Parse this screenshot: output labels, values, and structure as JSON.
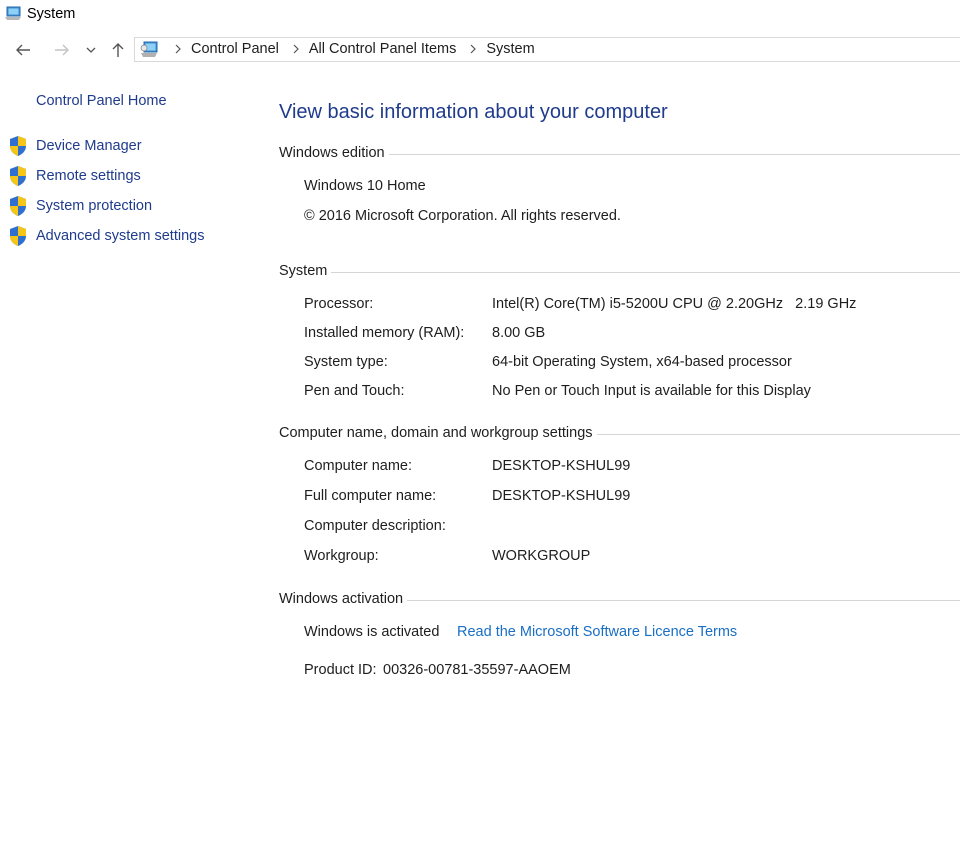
{
  "window": {
    "title": "System"
  },
  "nav": {
    "breadcrumbs": [
      "Control Panel",
      "All Control Panel Items",
      "System"
    ]
  },
  "sidebar": {
    "home": "Control Panel Home",
    "tasks": [
      {
        "label": "Device Manager"
      },
      {
        "label": "Remote settings"
      },
      {
        "label": "System protection"
      },
      {
        "label": "Advanced system settings"
      }
    ]
  },
  "main": {
    "heading": "View basic information about your computer",
    "edition": {
      "title": "Windows edition",
      "name": "Windows 10 Home",
      "copyright": "© 2016 Microsoft Corporation. All rights reserved."
    },
    "system": {
      "title": "System",
      "rows": [
        {
          "label": "Processor:",
          "value": "Intel(R) Core(TM) i5-5200U CPU @ 2.20GHz   2.19 GHz"
        },
        {
          "label": "Installed memory (RAM):",
          "value": "8.00 GB"
        },
        {
          "label": "System type:",
          "value": "64-bit Operating System, x64-based processor"
        },
        {
          "label": "Pen and Touch:",
          "value": "No Pen or Touch Input is available for this Display"
        }
      ]
    },
    "computer": {
      "title": "Computer name, domain and workgroup settings",
      "rows": [
        {
          "label": "Computer name:",
          "value": "DESKTOP-KSHUL99"
        },
        {
          "label": "Full computer name:",
          "value": "DESKTOP-KSHUL99"
        },
        {
          "label": "Computer description:",
          "value": ""
        },
        {
          "label": "Workgroup:",
          "value": "WORKGROUP"
        }
      ]
    },
    "activation": {
      "title": "Windows activation",
      "status": "Windows is activated",
      "license_link": "Read the Microsoft Software Licence Terms",
      "product_id_label": "Product ID:",
      "product_id": "00326-00781-35597-AAOEM"
    }
  },
  "colors": {
    "link_dark": "#1f3b8c",
    "link": "#1a6fc4",
    "rule": "#d5d5d5"
  }
}
